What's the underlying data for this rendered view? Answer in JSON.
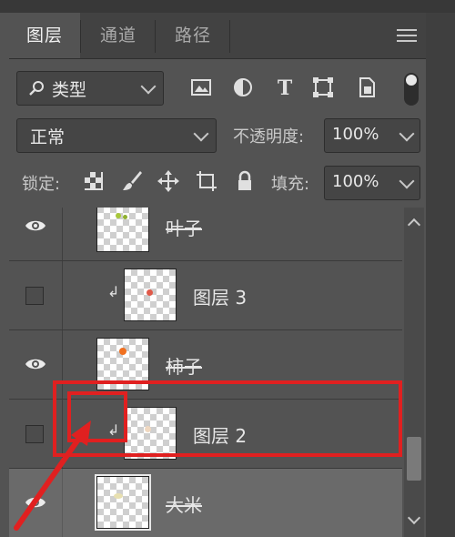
{
  "tabs": [
    {
      "label": "图层",
      "active": true
    },
    {
      "label": "通道",
      "active": false
    },
    {
      "label": "路径",
      "active": false
    }
  ],
  "filter": {
    "search_icon": "magnifier-icon",
    "kind_label": "类型",
    "filter_icons": [
      "image-filter-icon",
      "adjustment-filter-icon",
      "text-filter-icon",
      "shape-filter-icon",
      "smartobject-filter-icon"
    ]
  },
  "blend": {
    "mode": "正常",
    "opacity_label": "不透明度:",
    "opacity_value": "100%"
  },
  "lock": {
    "label": "锁定:",
    "icons": [
      "lock-transparent-icon",
      "lock-image-icon",
      "lock-position-icon",
      "lock-artboard-icon",
      "lock-all-icon"
    ],
    "fill_label": "填充:",
    "fill_value": "100%"
  },
  "layers": [
    {
      "name": "叶子",
      "visible": true,
      "clipped": false,
      "dot_color": "#a8c83a"
    },
    {
      "name": "图层 3",
      "visible": false,
      "clipped": true,
      "dot_color": "#e05a4a"
    },
    {
      "name": "柿子",
      "visible": true,
      "clipped": false,
      "dot_color": "#f07020"
    },
    {
      "name": "图层 2",
      "visible": false,
      "clipped": true,
      "dot_color": "#f0d8c0"
    },
    {
      "name": "大米",
      "visible": true,
      "clipped": false,
      "dot_color": "#e8e0b0"
    }
  ],
  "annotation_color": "#e02020"
}
